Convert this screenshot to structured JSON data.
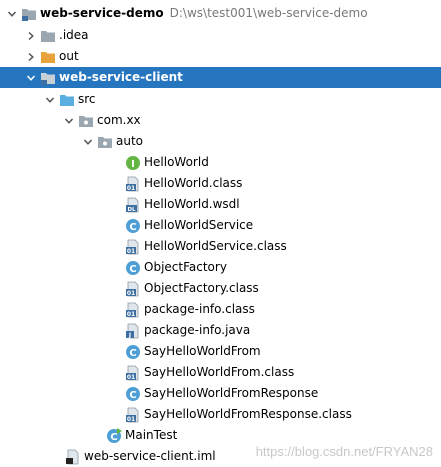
{
  "tree": {
    "root": {
      "label": "web-service-demo",
      "path": "D:\\ws\\test001\\web-service-demo",
      "icon": "module-folder-icon"
    },
    "idea": {
      "label": ".idea",
      "icon": "folder-icon"
    },
    "out": {
      "label": "out",
      "icon": "excluded-folder-icon"
    },
    "client": {
      "label": "web-service-client",
      "icon": "module-folder-icon"
    },
    "src": {
      "label": "src",
      "icon": "source-folder-icon"
    },
    "package": {
      "label": "com.xx",
      "icon": "package-icon"
    },
    "auto": {
      "label": "auto",
      "icon": "package-icon"
    },
    "files": [
      {
        "label": "HelloWorld",
        "icon": "interface-icon"
      },
      {
        "label": "HelloWorld.class",
        "icon": "class-file-icon"
      },
      {
        "label": "HelloWorld.wsdl",
        "icon": "wsdl-file-icon"
      },
      {
        "label": "HelloWorldService",
        "icon": "class-icon"
      },
      {
        "label": "HelloWorldService.class",
        "icon": "class-file-icon"
      },
      {
        "label": "ObjectFactory",
        "icon": "class-icon"
      },
      {
        "label": "ObjectFactory.class",
        "icon": "class-file-icon"
      },
      {
        "label": "package-info.class",
        "icon": "class-file-icon"
      },
      {
        "label": "package-info.java",
        "icon": "java-file-icon"
      },
      {
        "label": "SayHelloWorldFrom",
        "icon": "class-icon"
      },
      {
        "label": "SayHelloWorldFrom.class",
        "icon": "class-file-icon"
      },
      {
        "label": "SayHelloWorldFromResponse",
        "icon": "class-icon"
      },
      {
        "label": "SayHelloWorldFromResponse.class",
        "icon": "class-file-icon"
      }
    ],
    "main": {
      "label": "MainTest",
      "icon": "runnable-class-icon"
    },
    "iml": {
      "label": "web-service-client.iml",
      "icon": "iml-file-icon"
    }
  },
  "watermark": "https://blog.csdn.net/FRYAN28",
  "colors": {
    "selection": "#2675bf",
    "folder": "#9aa7b0",
    "excluded_folder": "#e8a33d",
    "source_folder": "#5aaee0",
    "class": "#4d9fd6",
    "interface": "#62b543",
    "runnable": "#62b543"
  }
}
